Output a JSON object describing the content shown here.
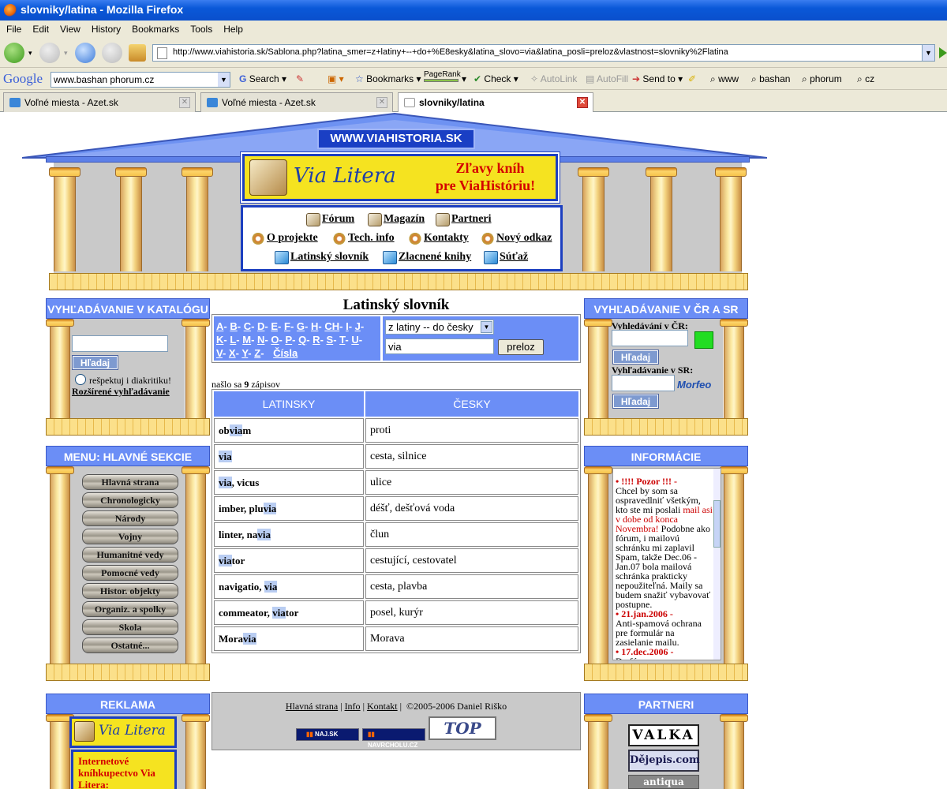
{
  "window": {
    "title": "slovniky/latina - Mozilla Firefox"
  },
  "menu": [
    "File",
    "Edit",
    "View",
    "History",
    "Bookmarks",
    "Tools",
    "Help"
  ],
  "address": {
    "url": "http://www.viahistoria.sk/Sablona.php?latina_smer=z+latiny+--+do+%E8esky&latina_slovo=via&latina_posli=preloz&vlastnost=slovniky%2Flatina"
  },
  "google": {
    "logo": "Google",
    "search_value": "www.bashan phorum.cz",
    "search_label": "Search",
    "bookmarks_label": "Bookmarks",
    "pagerank_label": "PageRank",
    "check_label": "Check",
    "autolink_label": "AutoLink",
    "autofill_label": "AutoFill",
    "sendto_label": "Send to",
    "words": [
      "www",
      "bashan",
      "phorum",
      "cz"
    ]
  },
  "tabs": [
    {
      "label": "Voľné miesta - Azet.sk"
    },
    {
      "label": "Voľné miesta - Azet.sk"
    },
    {
      "label": "slovniky/latina"
    }
  ],
  "site": {
    "domain": "WWW.VIAHISTORIA.SK",
    "banner_logo": "Via Litera",
    "banner_promo_line1": "Zľavy kníh",
    "banner_promo_line2": "pre ViaHistóriu!",
    "nav": {
      "forum": "Fórum",
      "magazin": "Magazín",
      "partneri": "Partneri",
      "o_projekte": "O projekte",
      "tech_info": "Tech. info",
      "kontakty": "Kontakty",
      "novy_odkaz": "Nový odkaz",
      "latinsky_slovnik": "Latinský slovník",
      "zlacnene_knihy": "Zlacnené knihy",
      "sutaz": "Súťaž"
    }
  },
  "left": {
    "catalog_title": "VYHĽADÁVANIE V KATALÓGU",
    "search_button": "Hľadaj",
    "diacritics_label": "rešpektuj i diakritiku!",
    "advanced_link": "Rozšírené vyhľadávanie",
    "menu_title": "MENU: HLAVNÉ SEKCIE",
    "menu_items": [
      "Hlavná strana",
      "Chronologicky",
      "Národy",
      "Vojny",
      "Humanitné vedy",
      "Pomocné vedy",
      "Histor. objekty",
      "Organiz. a spolky",
      "Skola",
      "Ostatné..."
    ],
    "ads_title": "REKLAMA",
    "ad_logo": "Via Litera",
    "ad_text": "Internetové kníhkupectvo Via Litera:"
  },
  "center": {
    "title": "Latinský slovník",
    "letters": [
      [
        "A",
        "B",
        "C",
        "D",
        "E",
        "F",
        "G",
        "H",
        "CH",
        "I",
        "J"
      ],
      [
        "K",
        "L",
        "M",
        "N",
        "O",
        "P",
        "Q",
        "R",
        "S",
        "T",
        "U"
      ],
      [
        "V",
        "X",
        "Y",
        "Z"
      ]
    ],
    "numbers_link": "Čísla",
    "direction_value": "z latiny -- do česky",
    "word_value": "via",
    "translate_button": "preloz",
    "found_prefix": "našlo sa ",
    "found_count": "9",
    "found_suffix": " zápisov",
    "col_latin": "LATINSKY",
    "col_czech": "ČESKY",
    "rows": [
      {
        "pre": "ob",
        "hl": "via",
        "post": "m",
        "czech": "proti"
      },
      {
        "pre": "",
        "hl": "via",
        "post": "",
        "czech": "cesta, silnice"
      },
      {
        "pre": "",
        "hl": "via",
        "post": ", vicus",
        "czech": "ulice"
      },
      {
        "pre": "imber, plu",
        "hl": "via",
        "post": "",
        "czech": "déšť, dešťová voda"
      },
      {
        "pre": "linter, na",
        "hl": "via",
        "post": "",
        "czech": "člun"
      },
      {
        "pre": "",
        "hl": "via",
        "post": "tor",
        "czech": "cestující, cestovatel"
      },
      {
        "pre": "navigatio, ",
        "hl": "via",
        "post": "",
        "czech": "cesta, plavba"
      },
      {
        "pre": "commeator, ",
        "hl": "via",
        "post": "tor",
        "czech": "posel, kurýr"
      },
      {
        "pre": "Mora",
        "hl": "via",
        "post": "",
        "czech": "Morava"
      }
    ],
    "footer_links": [
      "Hlavná strana",
      "Info",
      "Kontakt"
    ],
    "copyright": "©2005-2006 Daniel Riško",
    "badge_naj": "NAJ.SK",
    "badge_navrcholu": "NAVRCHOLU.CZ",
    "badge_top": "TOP"
  },
  "right": {
    "search_title": "VYHĽADÁVANIE V ČR A SR",
    "cr_label": "Vyhledávání v ČR:",
    "sr_label": "Vyhľadávanie v SR:",
    "search_button": "Hľadaj",
    "morfeo": "Morfeo",
    "info_title": "INFORMÁCIE",
    "info": [
      {
        "head": "!!!! Pozor !!!",
        "dash": " -",
        "body1": "Chcel by som sa ospravedlniť všetkým, kto ste mi poslali ",
        "red": "mail asi v dobe od konca Novembra!",
        "body2": " Podobne ako fórum, i mailovú schránku mi zaplavil Spam, takže Dec.06 - Jan.07 bola mailová schránka prakticky nepoužiteľná. Maily sa budem snažiť vybavovať postupne."
      },
      {
        "head": "21.jan.2006",
        "dash": " -",
        "body1": "Anti-spamová ochrana pre formulár na zasielanie mailu.",
        "red": "",
        "body2": ""
      },
      {
        "head": "17.dec.2006",
        "dash": " -",
        "body1": "Do fóra",
        "red": "",
        "body2": ""
      }
    ],
    "partners_title": "PARTNERI",
    "partner1": "VALKA",
    "partner2": "Dějepis.com",
    "partner3": "antiqua"
  },
  "colors": {
    "header_blue": "#6b8ef6",
    "link_blue_bg": "#b9cdf2",
    "gold": "#f6c24a",
    "red_text": "#cc0000"
  }
}
